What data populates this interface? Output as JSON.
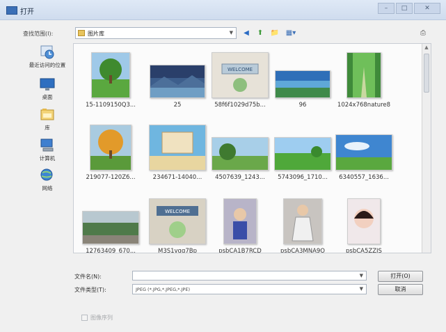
{
  "window": {
    "title": "打开",
    "controls": [
      "–",
      "□",
      "✕"
    ]
  },
  "lookin": {
    "label": "查找范围(I):",
    "value": "图片库"
  },
  "toolbar": {
    "back": "◀",
    "up": "⬆",
    "new_folder": "📁",
    "view": "▦▾",
    "extra": "⎙"
  },
  "places": [
    {
      "label": "最近访问的位置",
      "icon": "recent-places-icon"
    },
    {
      "label": "桌面",
      "icon": "desktop-icon"
    },
    {
      "label": "库",
      "icon": "libraries-icon"
    },
    {
      "label": "计算机",
      "icon": "computer-icon"
    },
    {
      "label": "网络",
      "icon": "network-icon"
    }
  ],
  "files": [
    {
      "name": "15-1109150Q3...",
      "thumb": "tree-landscape"
    },
    {
      "name": "25",
      "thumb": "mountain-lake"
    },
    {
      "name": "58f6f1029d75b...",
      "thumb": "welcome-sign"
    },
    {
      "name": "96",
      "thumb": "blue-river"
    },
    {
      "name": "1024x768nature8",
      "thumb": "green-path"
    },
    {
      "name": "219077-120Z6...",
      "thumb": "autumn-tree"
    },
    {
      "name": "234671-14040...",
      "thumb": "beach-frame"
    },
    {
      "name": "4507639_1243...",
      "thumb": "tree-field"
    },
    {
      "name": "5743096_1710...",
      "thumb": "green-meadow"
    },
    {
      "name": "6340557_1636...",
      "thumb": "sky-field"
    },
    {
      "name": "12763409_670...",
      "thumb": "river-road"
    },
    {
      "name": "M3S1vgg7Bp",
      "thumb": "welcome-board"
    },
    {
      "name": "psbCA1B7RCD",
      "thumb": "child-portrait"
    },
    {
      "name": "psbCA3MNA9O",
      "thumb": "girl-dress"
    },
    {
      "name": "psbCA5ZZJS",
      "thumb": "girl-face"
    }
  ],
  "filename": {
    "label": "文件名(N):",
    "value": ""
  },
  "filetype": {
    "label": "文件类型(T):",
    "value": "JPEG (*.JPG,*.JPEG,*.JPE)"
  },
  "buttons": {
    "open": "打开(O)",
    "cancel": "取消"
  },
  "checkbox": {
    "label": "图像序列",
    "checked": false
  }
}
